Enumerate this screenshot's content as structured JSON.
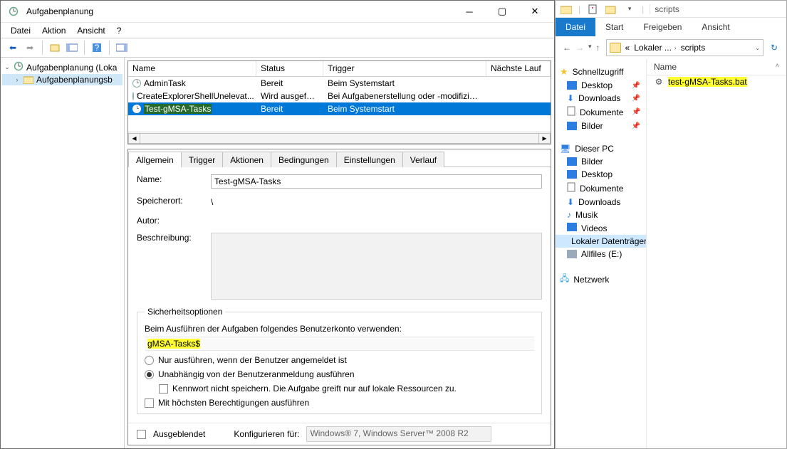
{
  "taskScheduler": {
    "title": "Aufgabenplanung",
    "menus": [
      "Datei",
      "Aktion",
      "Ansicht",
      "?"
    ],
    "tree": {
      "root": "Aufgabenplanung (Loka",
      "child": "Aufgabenplanungsb"
    },
    "columns": [
      "Name",
      "Status",
      "Trigger",
      "Nächste Lauf"
    ],
    "tasks": [
      {
        "name": "AdminTask",
        "status": "Bereit",
        "trigger": "Beim Systemstart"
      },
      {
        "name": "CreateExplorerShellUnelevat...",
        "status": "Wird ausgeführt",
        "trigger": "Bei Aufgabenerstellung oder -modifizierung"
      },
      {
        "name": "Test-gMSA-Tasks",
        "status": "Bereit",
        "trigger": "Beim Systemstart",
        "selected": true
      }
    ],
    "tabs": [
      "Allgemein",
      "Trigger",
      "Aktionen",
      "Bedingungen",
      "Einstellungen",
      "Verlauf"
    ],
    "general": {
      "labels": {
        "name": "Name:",
        "location": "Speicherort:",
        "author": "Autor:",
        "description": "Beschreibung:"
      },
      "name": "Test-gMSA-Tasks",
      "location": "\\",
      "author": "",
      "security": {
        "legend": "Sicherheitsoptionen",
        "promptText": "Beim Ausführen der Aufgaben folgendes Benutzerkonto verwenden:",
        "account": "gMSA-Tasks$",
        "opt_loggedon": "Nur ausführen, wenn der Benutzer angemeldet ist",
        "opt_independent": "Unabhängig von der Benutzeranmeldung ausführen",
        "opt_nopass": "Kennwort nicht speichern. Die Aufgabe greift nur auf lokale Ressourcen zu.",
        "opt_highest": "Mit höchsten Berechtigungen ausführen"
      },
      "footer": {
        "hidden": "Ausgeblendet",
        "configLabel": "Konfigurieren für:",
        "configValue": "Windows® 7, Windows Server™ 2008 R2"
      }
    }
  },
  "explorer": {
    "windowFolder": "scripts",
    "ribbon": [
      "Datei",
      "Start",
      "Freigeben",
      "Ansicht"
    ],
    "breadcrumb": {
      "p1": "Lokaler ...",
      "p2": "scripts",
      "prefix": "«"
    },
    "columnHeader": "Name",
    "nav": {
      "quick": "Schnellzugriff",
      "quickItems": [
        "Desktop",
        "Downloads",
        "Dokumente",
        "Bilder"
      ],
      "pc": "Dieser PC",
      "pcItems": [
        "Bilder",
        "Desktop",
        "Dokumente",
        "Downloads",
        "Musik",
        "Videos",
        "Lokaler Datenträger",
        "Allfiles (E:)"
      ],
      "network": "Netzwerk"
    },
    "files": [
      {
        "name": "test-gMSA-Tasks.bat",
        "highlight": true
      }
    ]
  }
}
